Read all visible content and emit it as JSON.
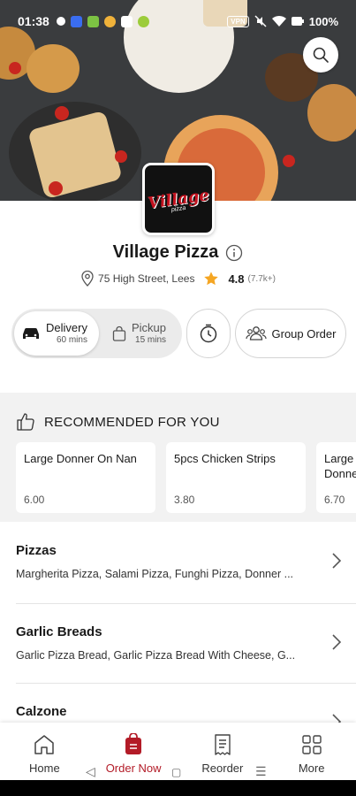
{
  "status_bar": {
    "time": "01:38",
    "battery": "100%",
    "badge": "VPN"
  },
  "restaurant": {
    "logo_text": "Village",
    "logo_sub": "pizza",
    "name": "Village Pizza",
    "address": "75 High Street, Lees",
    "rating": "4.8",
    "rating_count": "(7.7k+)"
  },
  "modes": {
    "delivery": {
      "label": "Delivery",
      "time": "60 mins"
    },
    "pickup": {
      "label": "Pickup",
      "time": "15 mins"
    },
    "group_order": "Group Order"
  },
  "recommended": {
    "title": "RECOMMENDED FOR YOU",
    "items": [
      {
        "name": "Large Donner On Nan",
        "price": "6.00"
      },
      {
        "name": "5pcs Chicken Strips",
        "price": "3.80"
      },
      {
        "name": "Large Donne",
        "price": "6.70"
      }
    ]
  },
  "categories": [
    {
      "name": "Pizzas",
      "items": "Margherita Pizza, Salami Pizza, Funghi Pizza, Donner ..."
    },
    {
      "name": "Garlic Breads",
      "items": "Garlic Pizza Bread, Garlic Pizza Bread With Cheese, G..."
    },
    {
      "name": "Calzone",
      "items": ""
    }
  ],
  "bottom_nav": [
    {
      "label": "Home",
      "icon": "home-icon"
    },
    {
      "label": "Order Now",
      "icon": "order-bag-icon"
    },
    {
      "label": "Reorder",
      "icon": "receipt-icon"
    },
    {
      "label": "More",
      "icon": "grid-icon"
    }
  ],
  "colors": {
    "accent": "#b31b27",
    "star": "#f5a623",
    "hero_bg": "#3a3c3e"
  }
}
